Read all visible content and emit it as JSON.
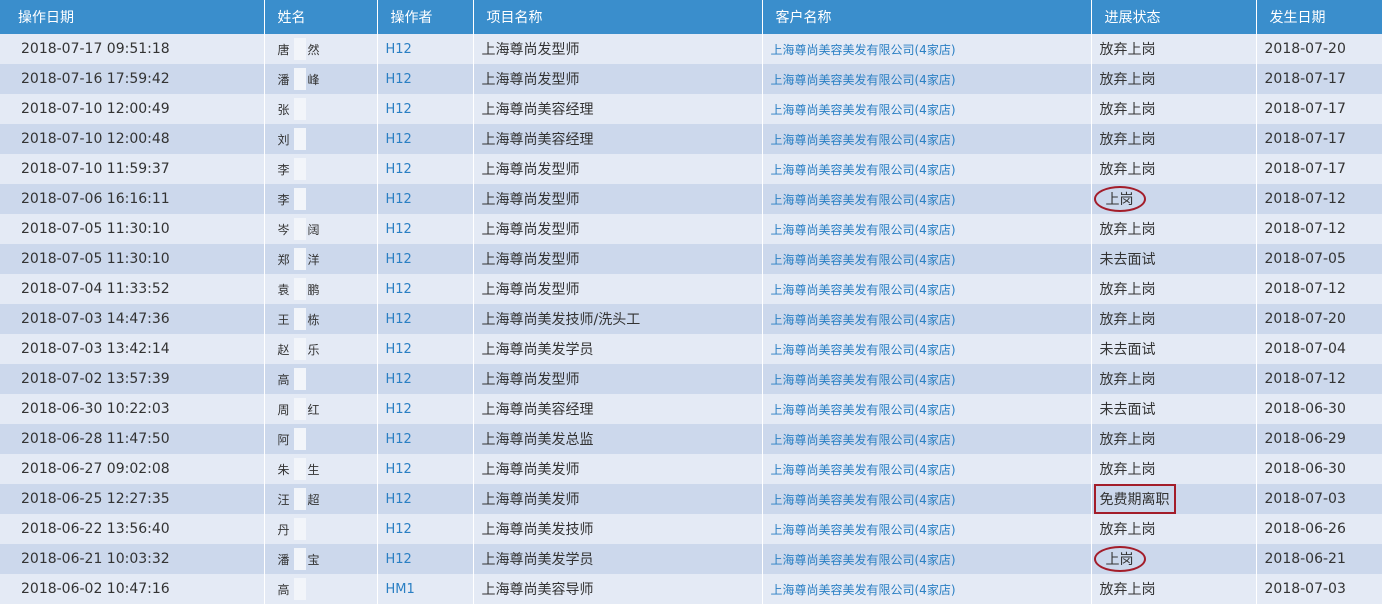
{
  "table": {
    "headers": {
      "date": "操作日期",
      "name": "姓名",
      "operator": "操作者",
      "project": "项目名称",
      "customer": "客户名称",
      "status": "进展状态",
      "occur": "发生日期"
    },
    "rows": [
      {
        "date": "2018-07-17 09:51:18",
        "name_first": "唐",
        "name_last": "然",
        "operator": "H12",
        "project": "上海尊尚发型师",
        "customer": "上海尊尚美容美发有限公司(4家店)",
        "status": "放弃上岗",
        "occur": "2018-07-20",
        "mark": ""
      },
      {
        "date": "2018-07-16 17:59:42",
        "name_first": "潘",
        "name_last": "峰",
        "operator": "H12",
        "project": "上海尊尚发型师",
        "customer": "上海尊尚美容美发有限公司(4家店)",
        "status": "放弃上岗",
        "occur": "2018-07-17",
        "mark": ""
      },
      {
        "date": "2018-07-10 12:00:49",
        "name_first": "张",
        "name_last": "",
        "operator": "H12",
        "project": "上海尊尚美容经理",
        "customer": "上海尊尚美容美发有限公司(4家店)",
        "status": "放弃上岗",
        "occur": "2018-07-17",
        "mark": ""
      },
      {
        "date": "2018-07-10 12:00:48",
        "name_first": "刘",
        "name_last": "",
        "operator": "H12",
        "project": "上海尊尚美容经理",
        "customer": "上海尊尚美容美发有限公司(4家店)",
        "status": "放弃上岗",
        "occur": "2018-07-17",
        "mark": ""
      },
      {
        "date": "2018-07-10 11:59:37",
        "name_first": "李",
        "name_last": "",
        "operator": "H12",
        "project": "上海尊尚发型师",
        "customer": "上海尊尚美容美发有限公司(4家店)",
        "status": "放弃上岗",
        "occur": "2018-07-17",
        "mark": ""
      },
      {
        "date": "2018-07-06 16:16:11",
        "name_first": "李",
        "name_last": "",
        "operator": "H12",
        "project": "上海尊尚发型师",
        "customer": "上海尊尚美容美发有限公司(4家店)",
        "status": "上岗",
        "occur": "2018-07-12",
        "mark": "ellipse"
      },
      {
        "date": "2018-07-05 11:30:10",
        "name_first": "岑",
        "name_last": "阔",
        "operator": "H12",
        "project": "上海尊尚发型师",
        "customer": "上海尊尚美容美发有限公司(4家店)",
        "status": "放弃上岗",
        "occur": "2018-07-12",
        "mark": ""
      },
      {
        "date": "2018-07-05 11:30:10",
        "name_first": "郑",
        "name_last": "洋",
        "operator": "H12",
        "project": "上海尊尚发型师",
        "customer": "上海尊尚美容美发有限公司(4家店)",
        "status": "未去面试",
        "occur": "2018-07-05",
        "mark": ""
      },
      {
        "date": "2018-07-04 11:33:52",
        "name_first": "袁",
        "name_last": "鹏",
        "operator": "H12",
        "project": "上海尊尚发型师",
        "customer": "上海尊尚美容美发有限公司(4家店)",
        "status": "放弃上岗",
        "occur": "2018-07-12",
        "mark": ""
      },
      {
        "date": "2018-07-03 14:47:36",
        "name_first": "王",
        "name_last": "栋",
        "operator": "H12",
        "project": "上海尊尚美发技师/洗头工",
        "customer": "上海尊尚美容美发有限公司(4家店)",
        "status": "放弃上岗",
        "occur": "2018-07-20",
        "mark": ""
      },
      {
        "date": "2018-07-03 13:42:14",
        "name_first": "赵",
        "name_last": "乐",
        "operator": "H12",
        "project": "上海尊尚美发学员",
        "customer": "上海尊尚美容美发有限公司(4家店)",
        "status": "未去面试",
        "occur": "2018-07-04",
        "mark": ""
      },
      {
        "date": "2018-07-02 13:57:39",
        "name_first": "高",
        "name_last": "",
        "operator": "H12",
        "project": "上海尊尚发型师",
        "customer": "上海尊尚美容美发有限公司(4家店)",
        "status": "放弃上岗",
        "occur": "2018-07-12",
        "mark": ""
      },
      {
        "date": "2018-06-30 10:22:03",
        "name_first": "周",
        "name_last": "红",
        "operator": "H12",
        "project": "上海尊尚美容经理",
        "customer": "上海尊尚美容美发有限公司(4家店)",
        "status": "未去面试",
        "occur": "2018-06-30",
        "mark": ""
      },
      {
        "date": "2018-06-28 11:47:50",
        "name_first": "阿",
        "name_last": "",
        "operator": "H12",
        "project": "上海尊尚美发总监",
        "customer": "上海尊尚美容美发有限公司(4家店)",
        "status": "放弃上岗",
        "occur": "2018-06-29",
        "mark": ""
      },
      {
        "date": "2018-06-27 09:02:08",
        "name_first": "朱",
        "name_last": "生",
        "operator": "H12",
        "project": "上海尊尚美发师",
        "customer": "上海尊尚美容美发有限公司(4家店)",
        "status": "放弃上岗",
        "occur": "2018-06-30",
        "mark": ""
      },
      {
        "date": "2018-06-25 12:27:35",
        "name_first": "汪",
        "name_last": "超",
        "operator": "H12",
        "project": "上海尊尚美发师",
        "customer": "上海尊尚美容美发有限公司(4家店)",
        "status": "免费期离职",
        "occur": "2018-07-03",
        "mark": "box"
      },
      {
        "date": "2018-06-22 13:56:40",
        "name_first": "丹",
        "name_last": "",
        "operator": "H12",
        "project": "上海尊尚美发技师",
        "customer": "上海尊尚美容美发有限公司(4家店)",
        "status": "放弃上岗",
        "occur": "2018-06-26",
        "mark": ""
      },
      {
        "date": "2018-06-21 10:03:32",
        "name_first": "潘",
        "name_last": "宝",
        "operator": "H12",
        "project": "上海尊尚美发学员",
        "customer": "上海尊尚美容美发有限公司(4家店)",
        "status": "上岗",
        "occur": "2018-06-21",
        "mark": "ellipse"
      },
      {
        "date": "2018-06-02 10:47:16",
        "name_first": "高",
        "name_last": "",
        "operator": "HM1",
        "project": "上海尊尚美容导师",
        "customer": "上海尊尚美容美发有限公司(4家店)",
        "status": "放弃上岗",
        "occur": "2018-07-03",
        "mark": ""
      }
    ]
  }
}
